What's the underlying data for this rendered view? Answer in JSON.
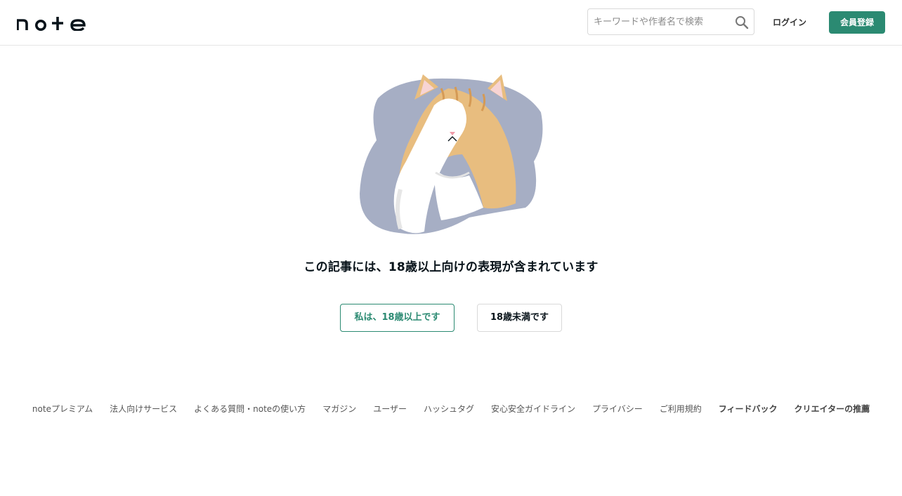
{
  "header": {
    "logo_text": "note",
    "search": {
      "placeholder": "キーワードや作者名で検索",
      "value": ""
    },
    "login_label": "ログイン",
    "signup_label": "会員登録"
  },
  "main": {
    "illustration": "cat-covering-eyes",
    "notice": "この記事には、18歳以上向けの表現が含まれています",
    "adult_button_label": "私は、18歳以上です",
    "minor_button_label": "18歳未満です"
  },
  "footer": {
    "links": [
      {
        "label": "noteプレミアム"
      },
      {
        "label": "法人向けサービス"
      },
      {
        "label": "よくある質問・noteの使い方"
      },
      {
        "label": "マガジン"
      },
      {
        "label": "ユーザー"
      },
      {
        "label": "ハッシュタグ"
      },
      {
        "label": "安心安全ガイドライン"
      },
      {
        "label": "プライバシー"
      },
      {
        "label": "ご利用規約"
      },
      {
        "label": "フィードバック"
      },
      {
        "label": "クリエイターの推薦"
      }
    ]
  },
  "colors": {
    "accent": "#2b8a72",
    "illustration_bg": "#a6aec4",
    "cat_fur": "#e8bd7f"
  }
}
